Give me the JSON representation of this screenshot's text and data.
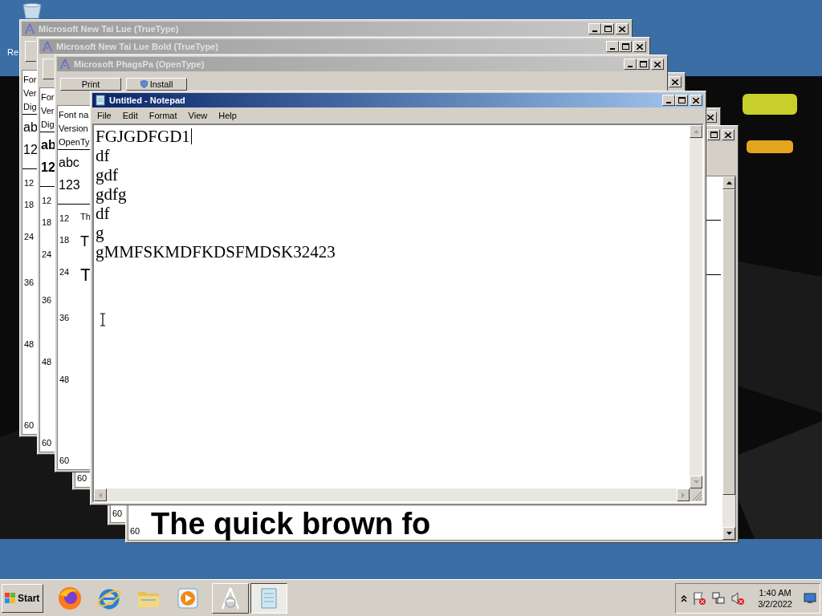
{
  "desktop": {
    "icon_label": "Re"
  },
  "font_windows": [
    {
      "title": "Microsoft New Tai Lue (TrueType)",
      "active": false,
      "button_edge": true,
      "info": [
        "For",
        "Ver",
        "Dig"
      ],
      "samples": [
        {
          "text": "ab",
          "bold": false
        },
        {
          "text": "12",
          "bold": false
        }
      ],
      "sizes": [
        {
          "size": "12"
        },
        {
          "size": "18"
        },
        {
          "size": "24"
        },
        {
          "size": "36"
        },
        {
          "size": "48"
        },
        {
          "size": "60"
        }
      ]
    },
    {
      "title": "Microsoft New Tai Lue Bold (TrueType)",
      "active": false,
      "button_edge": true,
      "info": [
        "For",
        "Ver",
        "Dig"
      ],
      "samples": [
        {
          "text": "ab",
          "bold": true
        },
        {
          "text": "12",
          "bold": true
        }
      ],
      "sizes": [
        {
          "size": "12"
        },
        {
          "size": "18"
        },
        {
          "size": "24"
        },
        {
          "size": "36"
        },
        {
          "size": "48"
        },
        {
          "size": "60"
        }
      ]
    },
    {
      "title": "Microsoft PhagsPa (OpenType)",
      "active": false,
      "buttons": [
        {
          "label": "Print",
          "kind": "plain"
        },
        {
          "label": "Install",
          "kind": "shield"
        }
      ],
      "info": [
        "Font na",
        "Version",
        "OpenTy"
      ],
      "samples": [
        {
          "text": "abc",
          "bold": false
        },
        {
          "text": "123",
          "bold": false
        }
      ],
      "sizes": [
        {
          "size": "12",
          "preview": "Th"
        },
        {
          "size": "18",
          "preview": "T"
        },
        {
          "size": "24",
          "preview": "T"
        },
        {
          "size": "36"
        },
        {
          "size": "48"
        },
        {
          "size": "60"
        }
      ]
    },
    {
      "active": false,
      "sizes": [
        {
          "size": "60"
        }
      ]
    },
    {
      "active": false,
      "sizes": [
        {
          "size": "60"
        }
      ]
    },
    {
      "active": false,
      "sizes": [
        {
          "size": "60",
          "preview": "The quick brown fo"
        }
      ]
    }
  ],
  "notepad": {
    "title": "Untitled - Notepad",
    "active": true,
    "menu": [
      "File",
      "Edit",
      "Format",
      "View",
      "Help"
    ],
    "lines": [
      {
        "text": "FGJGDFGD1",
        "caret": true
      },
      {
        "text": "df",
        "caret": false
      },
      {
        "text": "gdf",
        "caret": false
      },
      {
        "text": "gdfg",
        "caret": false
      },
      {
        "text": "df",
        "caret": false
      },
      {
        "text": "g",
        "caret": false
      },
      {
        "text": "gMMFSKMDFKDSFMDSK32423",
        "caret": false
      }
    ]
  },
  "taskbar": {
    "start_label": "Start",
    "pinned": [
      {
        "kind": "firefox"
      },
      {
        "kind": "ie"
      },
      {
        "kind": "folder"
      },
      {
        "kind": "media"
      }
    ],
    "tasks": [
      {
        "kind": "font-viewer",
        "selected": false
      },
      {
        "kind": "notepad",
        "selected": true
      }
    ],
    "tray": [
      {
        "kind": "chevron"
      },
      {
        "kind": "flag"
      },
      {
        "kind": "network"
      },
      {
        "kind": "volume"
      }
    ],
    "time": "1:40 AM",
    "date": "3/2/2022"
  }
}
